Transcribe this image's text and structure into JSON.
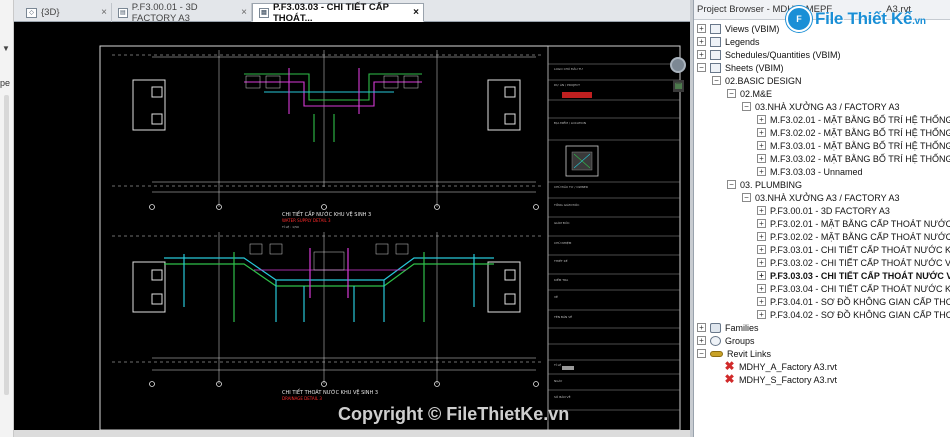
{
  "tabs": [
    {
      "label": "{3D}",
      "active": false
    },
    {
      "label": "P.F3.00.01 - 3D FACTORY A3",
      "active": false
    },
    {
      "label": "P.F3.03.03 - CHI TIẾT CẤP THOÁT...",
      "active": true
    }
  ],
  "left_panel": {
    "fragment": "pe"
  },
  "browser": {
    "title": "Project Browser - MDHY_MEPF",
    "title_tail": "A3.rvt",
    "logo_text": "File Thiết Kế",
    "logo_suffix": ".vn",
    "tree": [
      {
        "label": "Views (VBIM)",
        "toggle": "+",
        "icon": "views-icon"
      },
      {
        "label": "Legends",
        "toggle": "+",
        "icon": "legends-icon"
      },
      {
        "label": "Schedules/Quantities (VBIM)",
        "toggle": "+",
        "icon": "schedules-icon"
      },
      {
        "label": "Sheets (VBIM)",
        "toggle": "−",
        "icon": "sheets-icon"
      },
      {
        "label": "02.BASIC DESIGN",
        "toggle": "−"
      },
      {
        "label": "02.M&E",
        "toggle": "−"
      },
      {
        "label": "03.NHÀ XƯỞNG A3 / FACTORY A3",
        "toggle": "−"
      },
      {
        "label": "M.F3.02.01 - MẶT BẰNG BỐ TRÍ HỆ THỐNG THO",
        "toggle": "+"
      },
      {
        "label": "M.F3.02.02 - MẶT BẰNG BỐ TRÍ HỆ THỐNG THO",
        "toggle": "+"
      },
      {
        "label": "M.F3.03.01 - MẶT BẰNG BỐ TRÍ HỆ THỐNG CHI",
        "toggle": "+"
      },
      {
        "label": "M.F3.03.02 - MẶT BẰNG BỐ TRÍ HỆ THỐNG CHI",
        "toggle": "+"
      },
      {
        "label": "M.F3.03.03 - Unnamed",
        "toggle": "+"
      },
      {
        "label": "03. PLUMBING",
        "toggle": "−"
      },
      {
        "label": "03.NHÀ XƯỞNG A3 / FACTORY A3",
        "toggle": "−"
      },
      {
        "label": "P.F3.00.01 - 3D FACTORY A3",
        "toggle": "+"
      },
      {
        "label": "P.F3.02.01 - MẶT BẰNG CẤP THOÁT NƯỚC TỔN",
        "toggle": "+"
      },
      {
        "label": "P.F3.02.02 - MẶT BẰNG CẤP THOÁT NƯỚC TỔN",
        "toggle": "+"
      },
      {
        "label": "P.F3.03.01 - CHI TIẾT CẤP THOÁT NƯỚC KHU VỆ",
        "toggle": "+"
      },
      {
        "label": "P.F3.03.02 - CHI TIẾT CẤP THOÁT NƯỚC VỆ SINH",
        "toggle": "+"
      },
      {
        "label": "P.F3.03.03 - CHI TIẾT CẤP THOÁT NƯỚC VỆ S",
        "toggle": "+",
        "bold": true
      },
      {
        "label": "P.F3.03.04 - CHI TIẾT CẤP THOÁT NƯỚC KHU VỆ",
        "toggle": "+"
      },
      {
        "label": "P.F3.04.01 - SƠ ĐỒ KHÔNG GIAN CẤP THOÁT N",
        "toggle": "+"
      },
      {
        "label": "P.F3.04.02 - SƠ ĐỒ KHÔNG GIAN CẤP THOÁT N",
        "toggle": "+"
      },
      {
        "label": "Families",
        "toggle": "+",
        "icon": "families-icon"
      },
      {
        "label": "Groups",
        "toggle": "+",
        "icon": "groups-icon"
      },
      {
        "label": "Revit Links",
        "toggle": "−",
        "icon": "revit-links-icon"
      },
      {
        "label": "MDHY_A_Factory A3.rvt",
        "icon": "unloaded-link-icon"
      },
      {
        "label": "MDHY_S_Factory A3.rvt",
        "icon": "unloaded-link-icon"
      }
    ]
  },
  "drawing": {
    "upper_title": "CHI TIẾT CẤP NƯỚC KHU VỆ SINH 3",
    "upper_sub": "WATER SUPPLY DETAIL 3",
    "lower_title": "CHI TIẾT THOÁT NƯỚC KHU VỆ SINH 3",
    "lower_sub": "DRAINAGE DETAIL 3",
    "scale": "TỈ LỆ : 1/50"
  },
  "watermark": "Copyright © FileThietKe.vn",
  "colors": {
    "canvas": "#000000",
    "pipe_green": "#2fbf4a",
    "pipe_cyan": "#27c8d8",
    "pipe_magenta": "#d63ad6",
    "red_text": "#ff2a2a",
    "logo_blue": "#1a8fd6"
  }
}
